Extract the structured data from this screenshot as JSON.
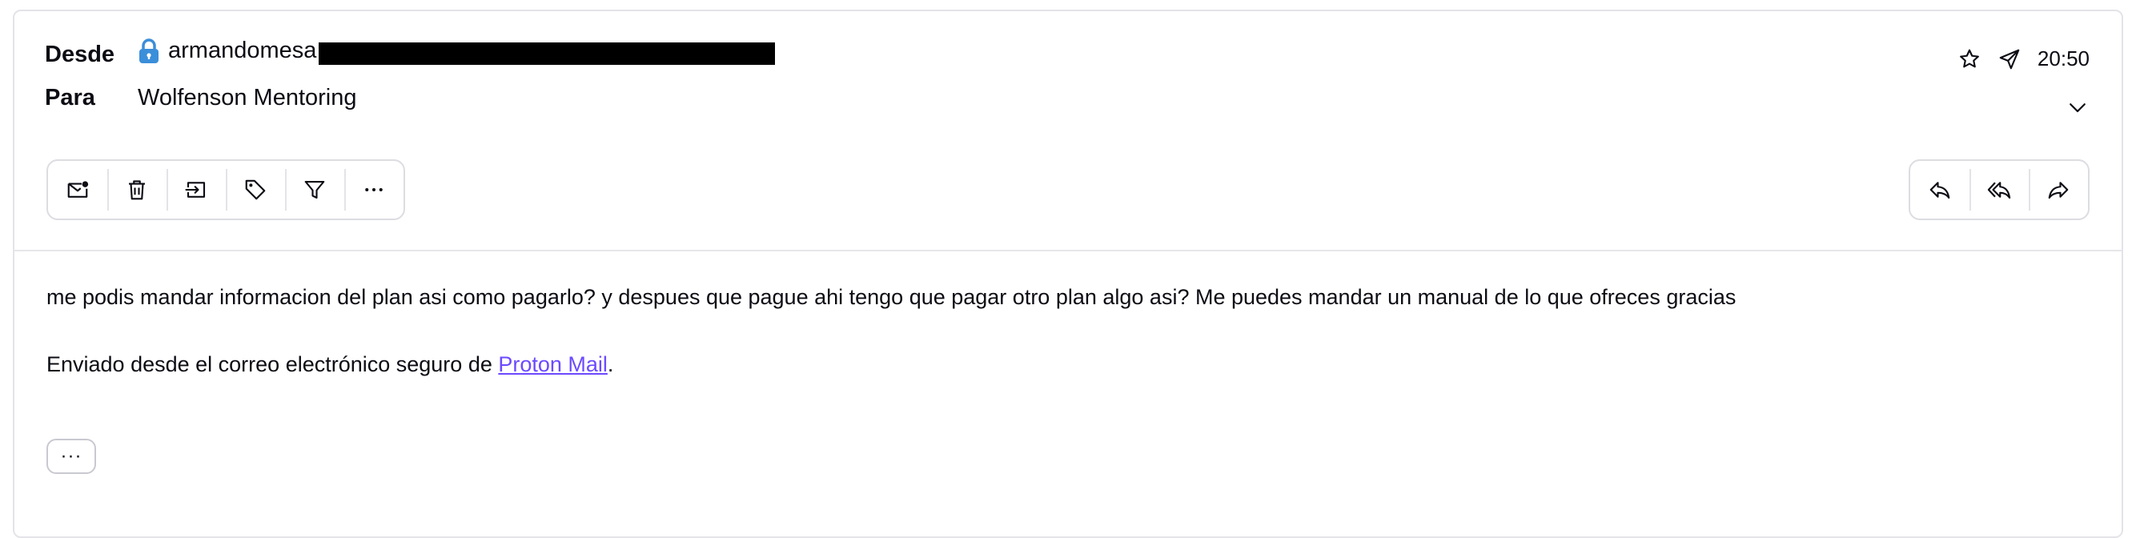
{
  "header": {
    "from_label": "Desde",
    "from_value": "armandomesa",
    "to_label": "Para",
    "to_value": "Wolfenson Mentoring",
    "time": "20:50"
  },
  "toolbar_left": [
    {
      "name": "mark-unread-icon"
    },
    {
      "name": "trash-icon"
    },
    {
      "name": "move-to-icon"
    },
    {
      "name": "label-icon"
    },
    {
      "name": "filter-icon"
    },
    {
      "name": "more-horizontal-icon",
      "text": "···"
    }
  ],
  "toolbar_right": [
    {
      "name": "reply-icon"
    },
    {
      "name": "reply-all-icon"
    },
    {
      "name": "forward-icon"
    }
  ],
  "message": {
    "body": "me podis mandar informacion del plan asi como pagarlo? y despues que pague ahi tengo que pagar otro plan algo asi? Me puedes mandar un manual de lo que ofreces gracias",
    "signature_prefix": "Enviado desde el correo electrónico seguro de ",
    "signature_link": "Proton Mail",
    "signature_suffix": ".",
    "expand_label": "···"
  },
  "colors": {
    "lock": "#3b8ed9",
    "link": "#6d4aff",
    "border": "#e3e3e8"
  }
}
